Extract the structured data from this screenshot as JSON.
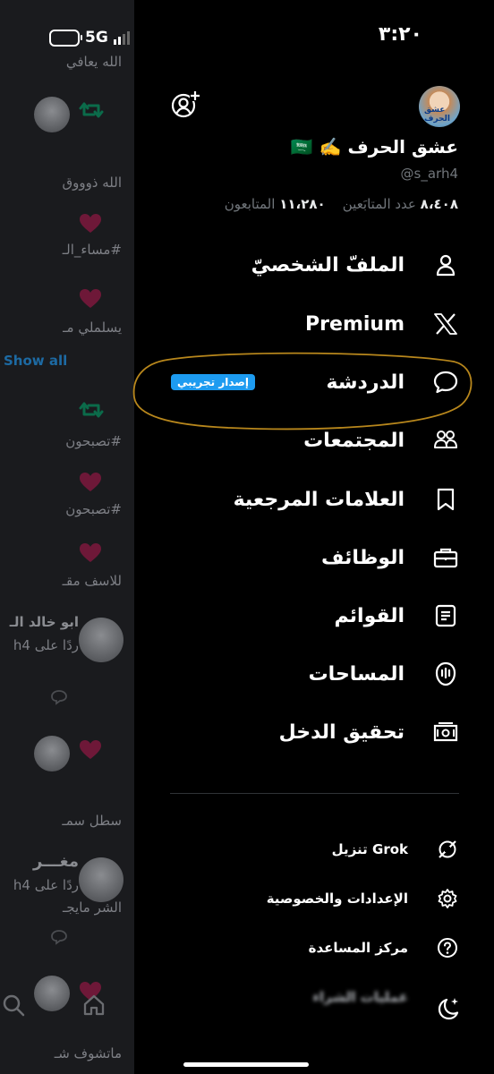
{
  "status_bar": {
    "time": "٣:٢٠",
    "network": "5G"
  },
  "profile": {
    "display_name": "عشق الحرف ✍️ 🇸🇦",
    "handle": "@s_arh4",
    "following_count": "٨،٤٠٨",
    "following_label": "عدد المتابَعين",
    "followers_count": "١١،٢٨٠",
    "followers_label": "المتابعون",
    "avatar_caption": "عشق الحرف"
  },
  "menu": [
    {
      "label": "الملفّ الشخصيّ",
      "icon": "person-icon"
    },
    {
      "label": "Premium",
      "icon": "x-logo-icon"
    },
    {
      "label": "الدردشة",
      "icon": "chat-icon",
      "badge": "إصدار تجريبي"
    },
    {
      "label": "المجتمعات",
      "icon": "communities-icon"
    },
    {
      "label": "العلامات المرجعية",
      "icon": "bookmark-icon"
    },
    {
      "label": "الوظائف",
      "icon": "briefcase-icon"
    },
    {
      "label": "القوائم",
      "icon": "list-icon"
    },
    {
      "label": "المساحات",
      "icon": "spaces-icon"
    },
    {
      "label": "تحقيق الدخل",
      "icon": "money-icon"
    }
  ],
  "sub_menu": [
    {
      "label": "تنزيل Grok",
      "icon": "grok-icon"
    },
    {
      "label": "الإعدادات والخصوصية",
      "icon": "gear-icon"
    },
    {
      "label": "مركز المساعدة",
      "icon": "help-icon"
    },
    {
      "label": "عمليات الشراء",
      "icon": "cart-icon"
    }
  ],
  "background_feed": {
    "lines": [
      "الله يعافي",
      "الله ذوووق",
      "#مساء_الـ",
      "يسلملي مـ",
      "Show all",
      "#تصبحون",
      "#تصبحون",
      "للاسف مقـ",
      "ابو خالد الـ",
      "ردًا على h4",
      "سطل سمـ",
      "مغـــر",
      "ردًا على h4",
      "الشر مايجـ",
      "ماتشوف شـ"
    ]
  },
  "colors": {
    "accent": "#1d9bf0",
    "highlight_circle": "#b8871c",
    "like_pink": "#f91880",
    "retweet_green": "#00ba7c"
  }
}
